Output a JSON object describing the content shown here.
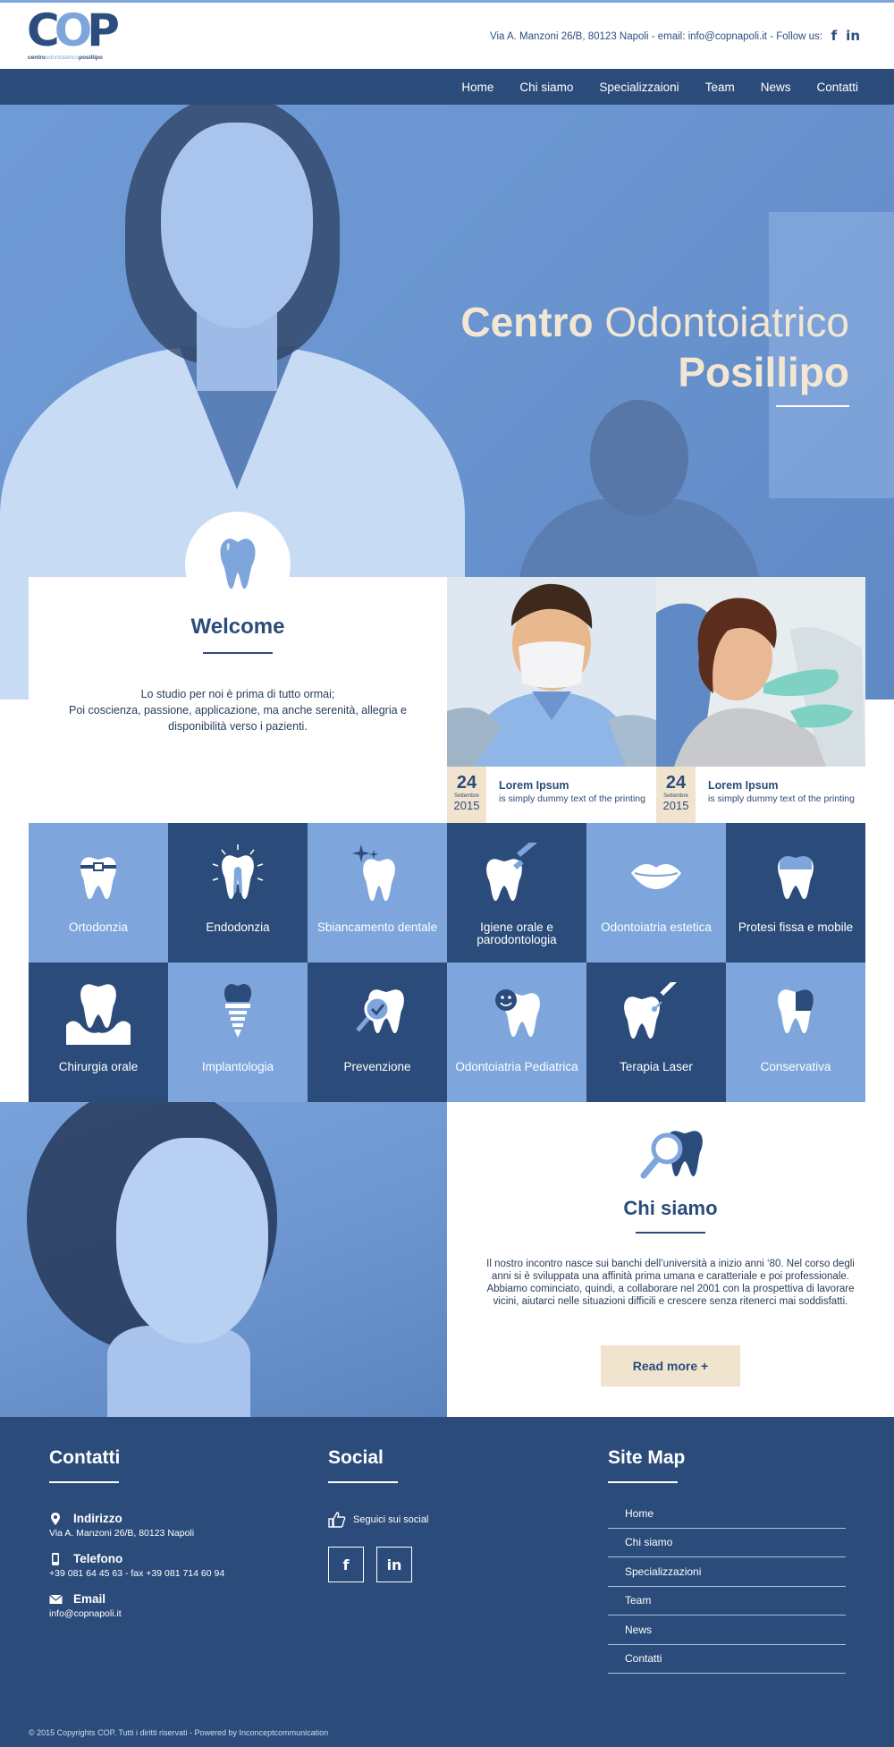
{
  "header": {
    "logo_letters": "COP",
    "logo_sub_1": "centro",
    "logo_sub_2": "odontoiatrico",
    "logo_sub_3": "posillipo",
    "contact_line": "Via A. Manzoni 26/B, 80123 Napoli -  email: info@copnapoli.it -  Follow us:",
    "social": [
      {
        "icon": "facebook-icon",
        "glyph": "f"
      },
      {
        "icon": "linkedin-icon",
        "glyph": "in"
      }
    ]
  },
  "nav": {
    "items": [
      "Home",
      "Chi siamo",
      "Specializzaioni",
      "Team",
      "News",
      "Contatti"
    ]
  },
  "hero": {
    "title_bold": "Centro",
    "title_light": "Odontoiatrico",
    "title_line2": "Posillipo"
  },
  "welcome": {
    "title": "Welcome",
    "text": "Lo studio per noi è prima di tutto ormai;\nPoi coscienza, passione, applicazione, ma anche serenità, allegria e disponibilità verso i pazienti."
  },
  "news": [
    {
      "day": "24",
      "month": "Settembre",
      "year": "2015",
      "title": "Lorem Ipsum",
      "subtitle": "is simply dummy text of the printing"
    },
    {
      "day": "24",
      "month": "Settembre",
      "year": "2015",
      "title": "Lorem Ipsum",
      "subtitle": "is simply dummy text of the printing"
    }
  ],
  "services": [
    {
      "label": "Ortodonzia",
      "tone": "light",
      "icon": "braces-tooth-icon"
    },
    {
      "label": "Endodonzia",
      "tone": "dark",
      "icon": "root-canal-tooth-icon"
    },
    {
      "label": "Sbiancamento dentale",
      "tone": "light",
      "icon": "sparkle-tooth-icon"
    },
    {
      "label": "Igiene orale e parodontologia",
      "tone": "dark",
      "icon": "toothbrush-tooth-icon"
    },
    {
      "label": "Odontoiatria estetica",
      "tone": "light",
      "icon": "lips-icon"
    },
    {
      "label": "Protesi fissa e mobile",
      "tone": "dark",
      "icon": "crown-tooth-icon"
    },
    {
      "label": "Chirurgia orale",
      "tone": "dark",
      "icon": "gum-tooth-icon"
    },
    {
      "label": "Implantologia",
      "tone": "light",
      "icon": "implant-icon"
    },
    {
      "label": "Prevenzione",
      "tone": "dark",
      "icon": "magnifier-tooth-icon"
    },
    {
      "label": "Odontoiatria Pediatrica",
      "tone": "light",
      "icon": "smiley-tooth-icon"
    },
    {
      "label": "Terapia Laser",
      "tone": "dark",
      "icon": "laser-tooth-icon"
    },
    {
      "label": "Conservativa",
      "tone": "light",
      "icon": "half-tooth-icon"
    }
  ],
  "chi_siamo": {
    "title": "Chi siamo",
    "text": "Il nostro incontro nasce sui banchi dell’università a inizio anni ‘80. Nel corso degli anni si è sviluppata una affinità prima umana e caratteriale e poi professionale. Abbiamo cominciato, quindi, a collaborare nel 2001 con la prospettiva di lavorare vicini, aiutarci nelle situazioni difficili e crescere senza ritenerci mai soddisfatti.",
    "button": "Read more +"
  },
  "footer": {
    "contatti": {
      "title": "Contatti",
      "address_label": "Indirizzo",
      "address_value": "Via A. Manzoni 26/B, 80123 Napoli",
      "phone_label": "Telefono",
      "phone_value": "+39 081 64 45 63 - fax +39 081 714 60 94",
      "email_label": "Email",
      "email_value": "info@copnapoli.it"
    },
    "social": {
      "title": "Social",
      "follow": "Seguici sui social",
      "facebook": "f",
      "linkedin": "in"
    },
    "sitemap": {
      "title": "Site Map",
      "links": [
        "Home",
        "Chi siamo",
        "Specializzazioni",
        "Team",
        "News",
        "Contatti"
      ]
    },
    "copyright": "© 2015 Copyrights COP. Tutti i diritti riservati - Powered by Inconceptcommunication"
  },
  "colors": {
    "dark_blue": "#2b4c7a",
    "light_blue": "#7ea6dc",
    "cream": "#f1e4cf"
  }
}
